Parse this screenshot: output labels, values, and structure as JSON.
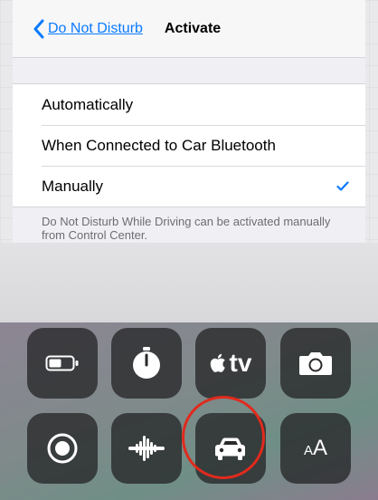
{
  "navbar": {
    "back_label": "Do Not Disturb",
    "title": "Activate"
  },
  "options": [
    {
      "label": "Automatically",
      "selected": false
    },
    {
      "label": "When Connected to Car Bluetooth",
      "selected": false
    },
    {
      "label": "Manually",
      "selected": true
    }
  ],
  "footer_text": "Do Not Disturb While Driving can be activated manually from Control Center.",
  "control_center": {
    "row1": [
      "battery-icon",
      "timer-icon",
      "apple-tv-remote-icon",
      "camera-icon"
    ],
    "row2": [
      "screen-recording-icon",
      "hearing-icon",
      "do-not-disturb-while-driving-icon",
      "text-size-icon"
    ],
    "apple_tv_label": "tv",
    "text_size_small": "A",
    "text_size_big": "A"
  },
  "colors": {
    "accent": "#0a7aff",
    "highlight_circle": "#e02a1d"
  }
}
